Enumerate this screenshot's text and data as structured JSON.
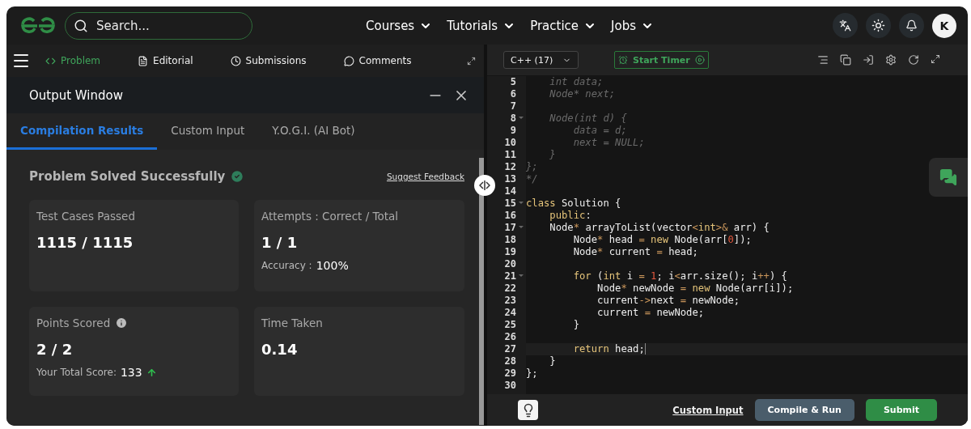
{
  "nav": {
    "search": {
      "placeholder": "Search..."
    },
    "menus": [
      "Courses",
      "Tutorials",
      "Practice",
      "Jobs"
    ],
    "avatar": "K"
  },
  "problem_tabs": [
    {
      "label": "Problem",
      "selected": true
    },
    {
      "label": "Editorial",
      "selected": false
    },
    {
      "label": "Submissions",
      "selected": false
    },
    {
      "label": "Comments",
      "selected": false
    }
  ],
  "output_window": {
    "title": "Output Window",
    "tabs": [
      {
        "label": "Compilation Results",
        "selected": true
      },
      {
        "label": "Custom Input",
        "selected": false
      },
      {
        "label": "Y.O.G.I. (AI Bot)",
        "selected": false
      }
    ],
    "status": "Problem Solved Successfully",
    "feedback_link": "Suggest Feedback",
    "cards": [
      {
        "title": "Test Cases Passed",
        "value": "1115 / 1115"
      },
      {
        "title": "Attempts : Correct / Total",
        "value": "1 / 1",
        "extra_label": "Accuracy :",
        "extra_value": "100%"
      },
      {
        "title": "Points Scored",
        "info": true,
        "value": "2 / 2",
        "extra_label": "Your Total Score:",
        "extra_value": "133",
        "trend_up": true
      },
      {
        "title": "Time Taken",
        "value": "0.14"
      }
    ]
  },
  "editor": {
    "language": "C++ (17)",
    "timer": "Start Timer",
    "lines": [
      {
        "number": "5",
        "fold": false,
        "active": false,
        "tokens": [
          {
            "kind": "comment",
            "text": "    int data;"
          }
        ]
      },
      {
        "number": "6",
        "fold": false,
        "active": false,
        "tokens": [
          {
            "kind": "comment",
            "text": "    Node* next;"
          }
        ]
      },
      {
        "number": "7",
        "fold": false,
        "active": false
      },
      {
        "number": "8",
        "fold": true,
        "active": false,
        "tokens": [
          {
            "kind": "comment",
            "text": "    Node(int d) {"
          }
        ]
      },
      {
        "number": "9",
        "fold": false,
        "active": false,
        "tokens": [
          {
            "kind": "comment",
            "text": "        data = d;"
          }
        ]
      },
      {
        "number": "10",
        "fold": false,
        "active": false,
        "tokens": [
          {
            "kind": "comment",
            "text": "        next = NULL;"
          }
        ]
      },
      {
        "number": "11",
        "fold": false,
        "active": false,
        "tokens": [
          {
            "kind": "comment",
            "text": "    }"
          }
        ]
      },
      {
        "number": "12",
        "fold": false,
        "active": false,
        "tokens": [
          {
            "kind": "comment",
            "text": "};"
          }
        ]
      },
      {
        "number": "13",
        "fold": false,
        "active": false,
        "tokens": [
          {
            "kind": "comment",
            "text": "*/"
          }
        ]
      },
      {
        "number": "14",
        "fold": false,
        "active": false
      },
      {
        "number": "15",
        "fold": true,
        "active": false,
        "tokens": [
          {
            "kind": "keyword",
            "text": "class"
          },
          {
            "kind": "plain",
            "text": " Solution {"
          }
        ]
      },
      {
        "number": "16",
        "fold": false,
        "active": false,
        "tokens": [
          {
            "kind": "keyword",
            "text": "    public"
          },
          {
            "kind": "plain",
            "text": ":"
          }
        ]
      },
      {
        "number": "17",
        "fold": true,
        "active": false,
        "tokens": [
          {
            "kind": "plain",
            "text": "    Node"
          },
          {
            "kind": "operator",
            "text": "*"
          },
          {
            "kind": "plain",
            "text": " arrayToList(vector"
          },
          {
            "kind": "operator",
            "text": "<"
          },
          {
            "kind": "keyword",
            "text": "int"
          },
          {
            "kind": "operator",
            "text": ">&"
          },
          {
            "kind": "plain",
            "text": " arr) {"
          }
        ]
      },
      {
        "number": "18",
        "fold": false,
        "active": false,
        "tokens": [
          {
            "kind": "plain",
            "text": "        Node"
          },
          {
            "kind": "operator",
            "text": "*"
          },
          {
            "kind": "plain",
            "text": " head "
          },
          {
            "kind": "operator",
            "text": "="
          },
          {
            "kind": "keyword",
            "text": " new"
          },
          {
            "kind": "plain",
            "text": " Node(arr["
          },
          {
            "kind": "number",
            "text": "0"
          },
          {
            "kind": "plain",
            "text": "]);"
          }
        ]
      },
      {
        "number": "19",
        "fold": false,
        "active": false,
        "tokens": [
          {
            "kind": "plain",
            "text": "        Node"
          },
          {
            "kind": "operator",
            "text": "*"
          },
          {
            "kind": "plain",
            "text": " current "
          },
          {
            "kind": "operator",
            "text": "="
          },
          {
            "kind": "plain",
            "text": " head;"
          }
        ]
      },
      {
        "number": "20",
        "fold": false,
        "active": false
      },
      {
        "number": "21",
        "fold": true,
        "active": false,
        "tokens": [
          {
            "kind": "keyword",
            "text": "        for"
          },
          {
            "kind": "plain",
            "text": " ("
          },
          {
            "kind": "keyword",
            "text": "int"
          },
          {
            "kind": "plain",
            "text": " i "
          },
          {
            "kind": "operator",
            "text": "="
          },
          {
            "kind": "number",
            "text": " 1"
          },
          {
            "kind": "plain",
            "text": "; i"
          },
          {
            "kind": "operator",
            "text": "<"
          },
          {
            "kind": "plain",
            "text": "arr.size(); i"
          },
          {
            "kind": "operator",
            "text": "++"
          },
          {
            "kind": "plain",
            "text": ") {"
          }
        ]
      },
      {
        "number": "22",
        "fold": false,
        "active": false,
        "tokens": [
          {
            "kind": "plain",
            "text": "            Node"
          },
          {
            "kind": "operator",
            "text": "*"
          },
          {
            "kind": "plain",
            "text": " newNode "
          },
          {
            "kind": "operator",
            "text": "="
          },
          {
            "kind": "keyword",
            "text": " new"
          },
          {
            "kind": "plain",
            "text": " Node(arr[i]);"
          }
        ]
      },
      {
        "number": "23",
        "fold": false,
        "active": false,
        "tokens": [
          {
            "kind": "plain",
            "text": "            current"
          },
          {
            "kind": "operator",
            "text": "->"
          },
          {
            "kind": "plain",
            "text": "next "
          },
          {
            "kind": "operator",
            "text": "="
          },
          {
            "kind": "plain",
            "text": " newNode;"
          }
        ]
      },
      {
        "number": "24",
        "fold": false,
        "active": false,
        "tokens": [
          {
            "kind": "plain",
            "text": "            current "
          },
          {
            "kind": "operator",
            "text": "="
          },
          {
            "kind": "plain",
            "text": " newNode;"
          }
        ]
      },
      {
        "number": "25",
        "fold": false,
        "active": false,
        "tokens": [
          {
            "kind": "plain",
            "text": "        }"
          }
        ]
      },
      {
        "number": "26",
        "fold": false,
        "active": false
      },
      {
        "number": "27",
        "fold": false,
        "active": true,
        "tokens": [
          {
            "kind": "keyword",
            "text": "        return"
          },
          {
            "kind": "plain",
            "text": " head;"
          }
        ]
      },
      {
        "number": "28",
        "fold": false,
        "active": false,
        "tokens": [
          {
            "kind": "plain",
            "text": "    }"
          }
        ]
      },
      {
        "number": "29",
        "fold": false,
        "active": false,
        "tokens": [
          {
            "kind": "plain",
            "text": "};"
          }
        ]
      },
      {
        "number": "30",
        "fold": false,
        "active": false
      }
    ],
    "custom_input": "Custom Input",
    "compile_button": "Compile & Run",
    "submit_button": "Submit"
  }
}
